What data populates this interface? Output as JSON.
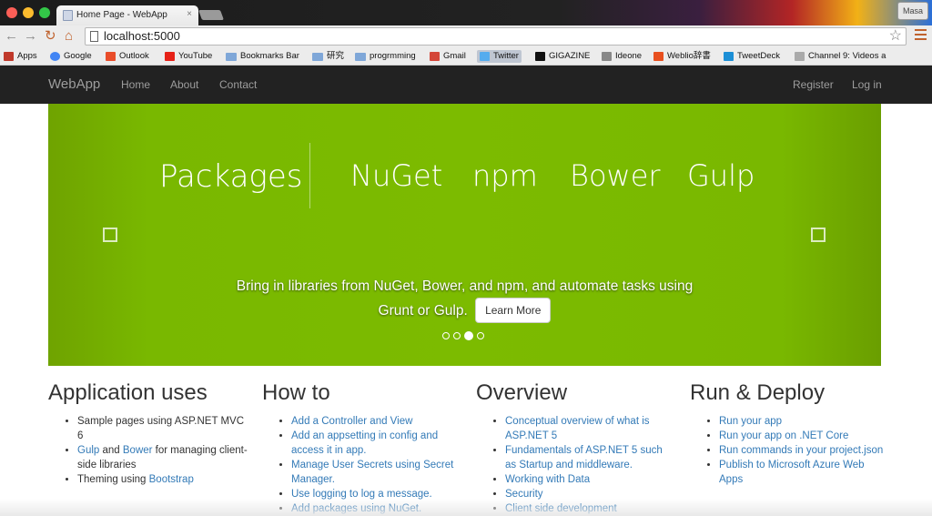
{
  "browser": {
    "tab_title": "Home Page - WebApp",
    "tab_close": "×",
    "profile": "Masa",
    "back": "←",
    "forward": "→",
    "reload": "↻",
    "home": "⌂",
    "star": "☆",
    "url": "localhost:5000"
  },
  "bookmarks": [
    {
      "label": "Apps",
      "icon": "apps-icon",
      "color": "#c0392b"
    },
    {
      "label": "Google",
      "icon": "google-icon",
      "color": "#4285f4"
    },
    {
      "label": "Outlook",
      "icon": "outlook-icon",
      "color": "#e94d2a"
    },
    {
      "label": "YouTube",
      "icon": "youtube-icon",
      "color": "#e62117"
    },
    {
      "label": "Bookmarks Bar",
      "icon": "folder-icon",
      "color": "#7fa7d8"
    },
    {
      "label": "研究",
      "icon": "folder-icon",
      "color": "#7fa7d8"
    },
    {
      "label": "progrmming",
      "icon": "folder-icon",
      "color": "#7fa7d8"
    },
    {
      "label": "Gmail",
      "icon": "gmail-icon",
      "color": "#d44638"
    },
    {
      "label": "Twitter",
      "icon": "twitter-icon",
      "color": "#55acee"
    },
    {
      "label": "GIGAZINE",
      "icon": "gigazine-icon",
      "color": "#111111"
    },
    {
      "label": "Ideone",
      "icon": "ideone-icon",
      "color": "#888888"
    },
    {
      "label": "Weblio辞書",
      "icon": "weblio-icon",
      "color": "#e8501f"
    },
    {
      "label": "TweetDeck",
      "icon": "tweetdeck-icon",
      "color": "#1c8fd6"
    },
    {
      "label": "Channel 9: Videos a",
      "icon": "channel9-icon",
      "color": "#aaaaaa"
    }
  ],
  "navbar": {
    "brand": "WebApp",
    "links": [
      "Home",
      "About",
      "Contact"
    ],
    "right": [
      "Register",
      "Log in"
    ]
  },
  "carousel": {
    "heading": "Packages",
    "items": [
      "NuGet",
      "npm",
      "Bower",
      "Gulp"
    ],
    "caption_line1": "Bring in libraries from NuGet, Bower, and npm, and automate tasks using",
    "caption_line2": "Grunt or Gulp.",
    "button": "Learn More",
    "active_slide": 3,
    "slide_count": 4,
    "accent": "#7cbb00"
  },
  "columns": [
    {
      "title": "Application uses",
      "items": [
        {
          "parts": [
            {
              "t": "Sample pages using ASP.NET MVC 6",
              "link": false
            }
          ]
        },
        {
          "parts": [
            {
              "t": "Gulp",
              "link": true
            },
            {
              "t": " and ",
              "link": false
            },
            {
              "t": "Bower",
              "link": true
            },
            {
              "t": " for managing client-side libraries",
              "link": false
            }
          ]
        },
        {
          "parts": [
            {
              "t": "Theming using ",
              "link": false
            },
            {
              "t": "Bootstrap",
              "link": true
            }
          ]
        }
      ]
    },
    {
      "title": "How to",
      "items": [
        {
          "parts": [
            {
              "t": "Add a Controller and View",
              "link": true
            }
          ]
        },
        {
          "parts": [
            {
              "t": "Add an appsetting in config and access it in app.",
              "link": true
            }
          ]
        },
        {
          "parts": [
            {
              "t": "Manage User Secrets using Secret Manager.",
              "link": true
            }
          ]
        },
        {
          "parts": [
            {
              "t": "Use logging to log a message.",
              "link": true
            }
          ]
        },
        {
          "parts": [
            {
              "t": "Add packages using NuGet.",
              "link": true
            }
          ]
        }
      ]
    },
    {
      "title": "Overview",
      "items": [
        {
          "parts": [
            {
              "t": "Conceptual overview of what is ASP.NET 5",
              "link": true
            }
          ]
        },
        {
          "parts": [
            {
              "t": "Fundamentals of ASP.NET 5 such as Startup and middleware.",
              "link": true
            }
          ]
        },
        {
          "parts": [
            {
              "t": "Working with Data",
              "link": true
            }
          ]
        },
        {
          "parts": [
            {
              "t": "Security",
              "link": true
            }
          ]
        },
        {
          "parts": [
            {
              "t": "Client side development",
              "link": true
            }
          ]
        }
      ]
    },
    {
      "title": "Run & Deploy",
      "items": [
        {
          "parts": [
            {
              "t": "Run your app",
              "link": true
            }
          ]
        },
        {
          "parts": [
            {
              "t": "Run your app on .NET Core",
              "link": true
            }
          ]
        },
        {
          "parts": [
            {
              "t": "Run commands in your project.json",
              "link": true
            }
          ]
        },
        {
          "parts": [
            {
              "t": "Publish to Microsoft Azure Web Apps",
              "link": true
            }
          ]
        }
      ]
    }
  ]
}
